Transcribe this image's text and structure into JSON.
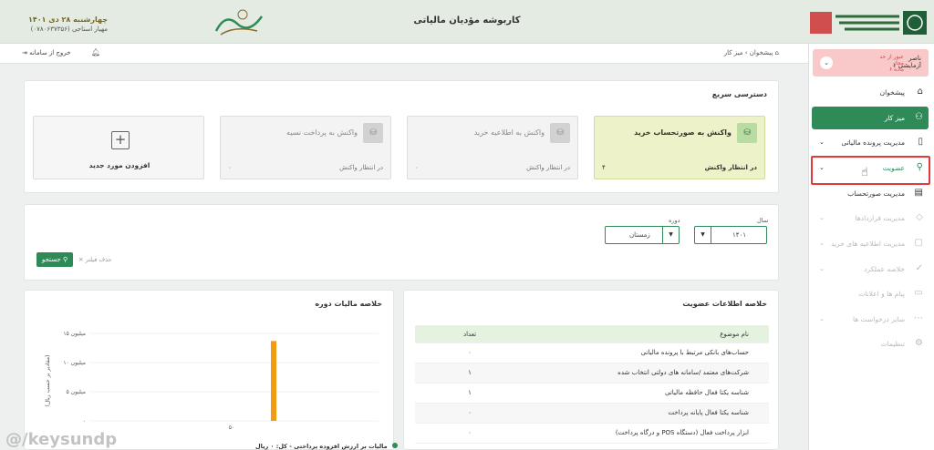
{
  "header": {
    "title": "کاربوشه مؤدیان مالیاتی",
    "date": "چهارشنبه ۲۸ دی ۱۴۰۱",
    "user_line": "مهیار استاجی (۰۷۸۰۶۳۷۳۵۶)"
  },
  "topbar": {
    "breadcrumb_home": "پیشخوان",
    "breadcrumb_sep": "›",
    "breadcrumb_current": "میز کار",
    "exit_label": "خروج از سامانه",
    "home_icon": "home-icon",
    "exit_icon": "logout-icon",
    "bell_icon": "bell-icon"
  },
  "user": {
    "name": "ناصر",
    "sub": "آزمایشی ۱",
    "warning": "عبور از حد مجاز",
    "warning_sub": "ماده ۶"
  },
  "sidebar": {
    "items": [
      {
        "label": "پیشخوان",
        "icon": "home-icon"
      },
      {
        "label": "میز کار",
        "icon": "users-icon"
      },
      {
        "label": "مدیریت پرونده مالیاتی",
        "icon": "file-icon"
      },
      {
        "label": "عضویت",
        "icon": "user-icon"
      },
      {
        "label": "مدیریت صورتحساب",
        "icon": "invoice-icon"
      },
      {
        "label": "مدیریت قراردادها",
        "icon": "contract-icon"
      },
      {
        "label": "مدیریت اطلاعیه های خرید",
        "icon": "bag-icon"
      },
      {
        "label": "خلاصه عملکرد",
        "icon": "check-icon"
      },
      {
        "label": "پیام ها و اعلانات",
        "icon": "message-icon"
      },
      {
        "label": "سایر درخواست ها",
        "icon": "dots-icon"
      },
      {
        "label": "تنظیمات",
        "icon": "settings-icon"
      }
    ]
  },
  "quick_access": {
    "title": "دسترسی سریع",
    "cards": [
      {
        "title": "واکنش به صورتحساب خرید",
        "status": "در انتظار واکنش",
        "count": "۴"
      },
      {
        "title": "واکنش به اطلاعیه خرید",
        "status": "در انتظار واکنش",
        "count": "۰"
      },
      {
        "title": "واکنش به پرداخت نسیه",
        "status": "در انتظار واکنش",
        "count": "۰"
      }
    ],
    "add_label": "افزودن مورد جدید"
  },
  "filters": {
    "year_label": "سال",
    "year_value": "۱۴۰۱",
    "period_label": "دوره",
    "period_value": "زمستان",
    "clear_label": "حذف فیلتر",
    "search_label": "جستجو"
  },
  "membership": {
    "title": "خلاصه اطلاعات عضویت",
    "col_subject": "نام موضوع",
    "col_count": "تعداد",
    "rows": [
      {
        "subject": "حساب‌های بانکی مرتبط با پرونده مالیاتی",
        "count": "۰"
      },
      {
        "subject": "شرکت‌های معتمد /سامانه های دولتی انتخاب شده",
        "count": "۱"
      },
      {
        "subject": "شناسه یکتا فعال حافظه مالیاتی",
        "count": "۱"
      },
      {
        "subject": "شناسه یکتا فعال پایانه پرداخت",
        "count": "۰"
      },
      {
        "subject": "ابزار پرداخت فعال (دستگاه POS و درگاه پرداخت)",
        "count": "۰"
      }
    ]
  },
  "chart_data": {
    "type": "bar",
    "title": "خلاصه مالیات دوره",
    "ylabel": "(مقادیر بر حسب ریال)",
    "xlabel": "",
    "ylim": [
      0,
      15
    ],
    "yticks": [
      "۰",
      "۵ میلیون",
      "۱۰ میلیون",
      "۱۵ میلیون"
    ],
    "categories": [
      "۵۰"
    ],
    "series": [
      {
        "name": "مالیات بر ارزش افزوده پرداختی - کل: ۰ ریال",
        "values": [
          13.7
        ],
        "color": "#f39c12"
      }
    ],
    "grid": true,
    "legend_position": "bottom"
  },
  "watermark": "@/keysundp"
}
